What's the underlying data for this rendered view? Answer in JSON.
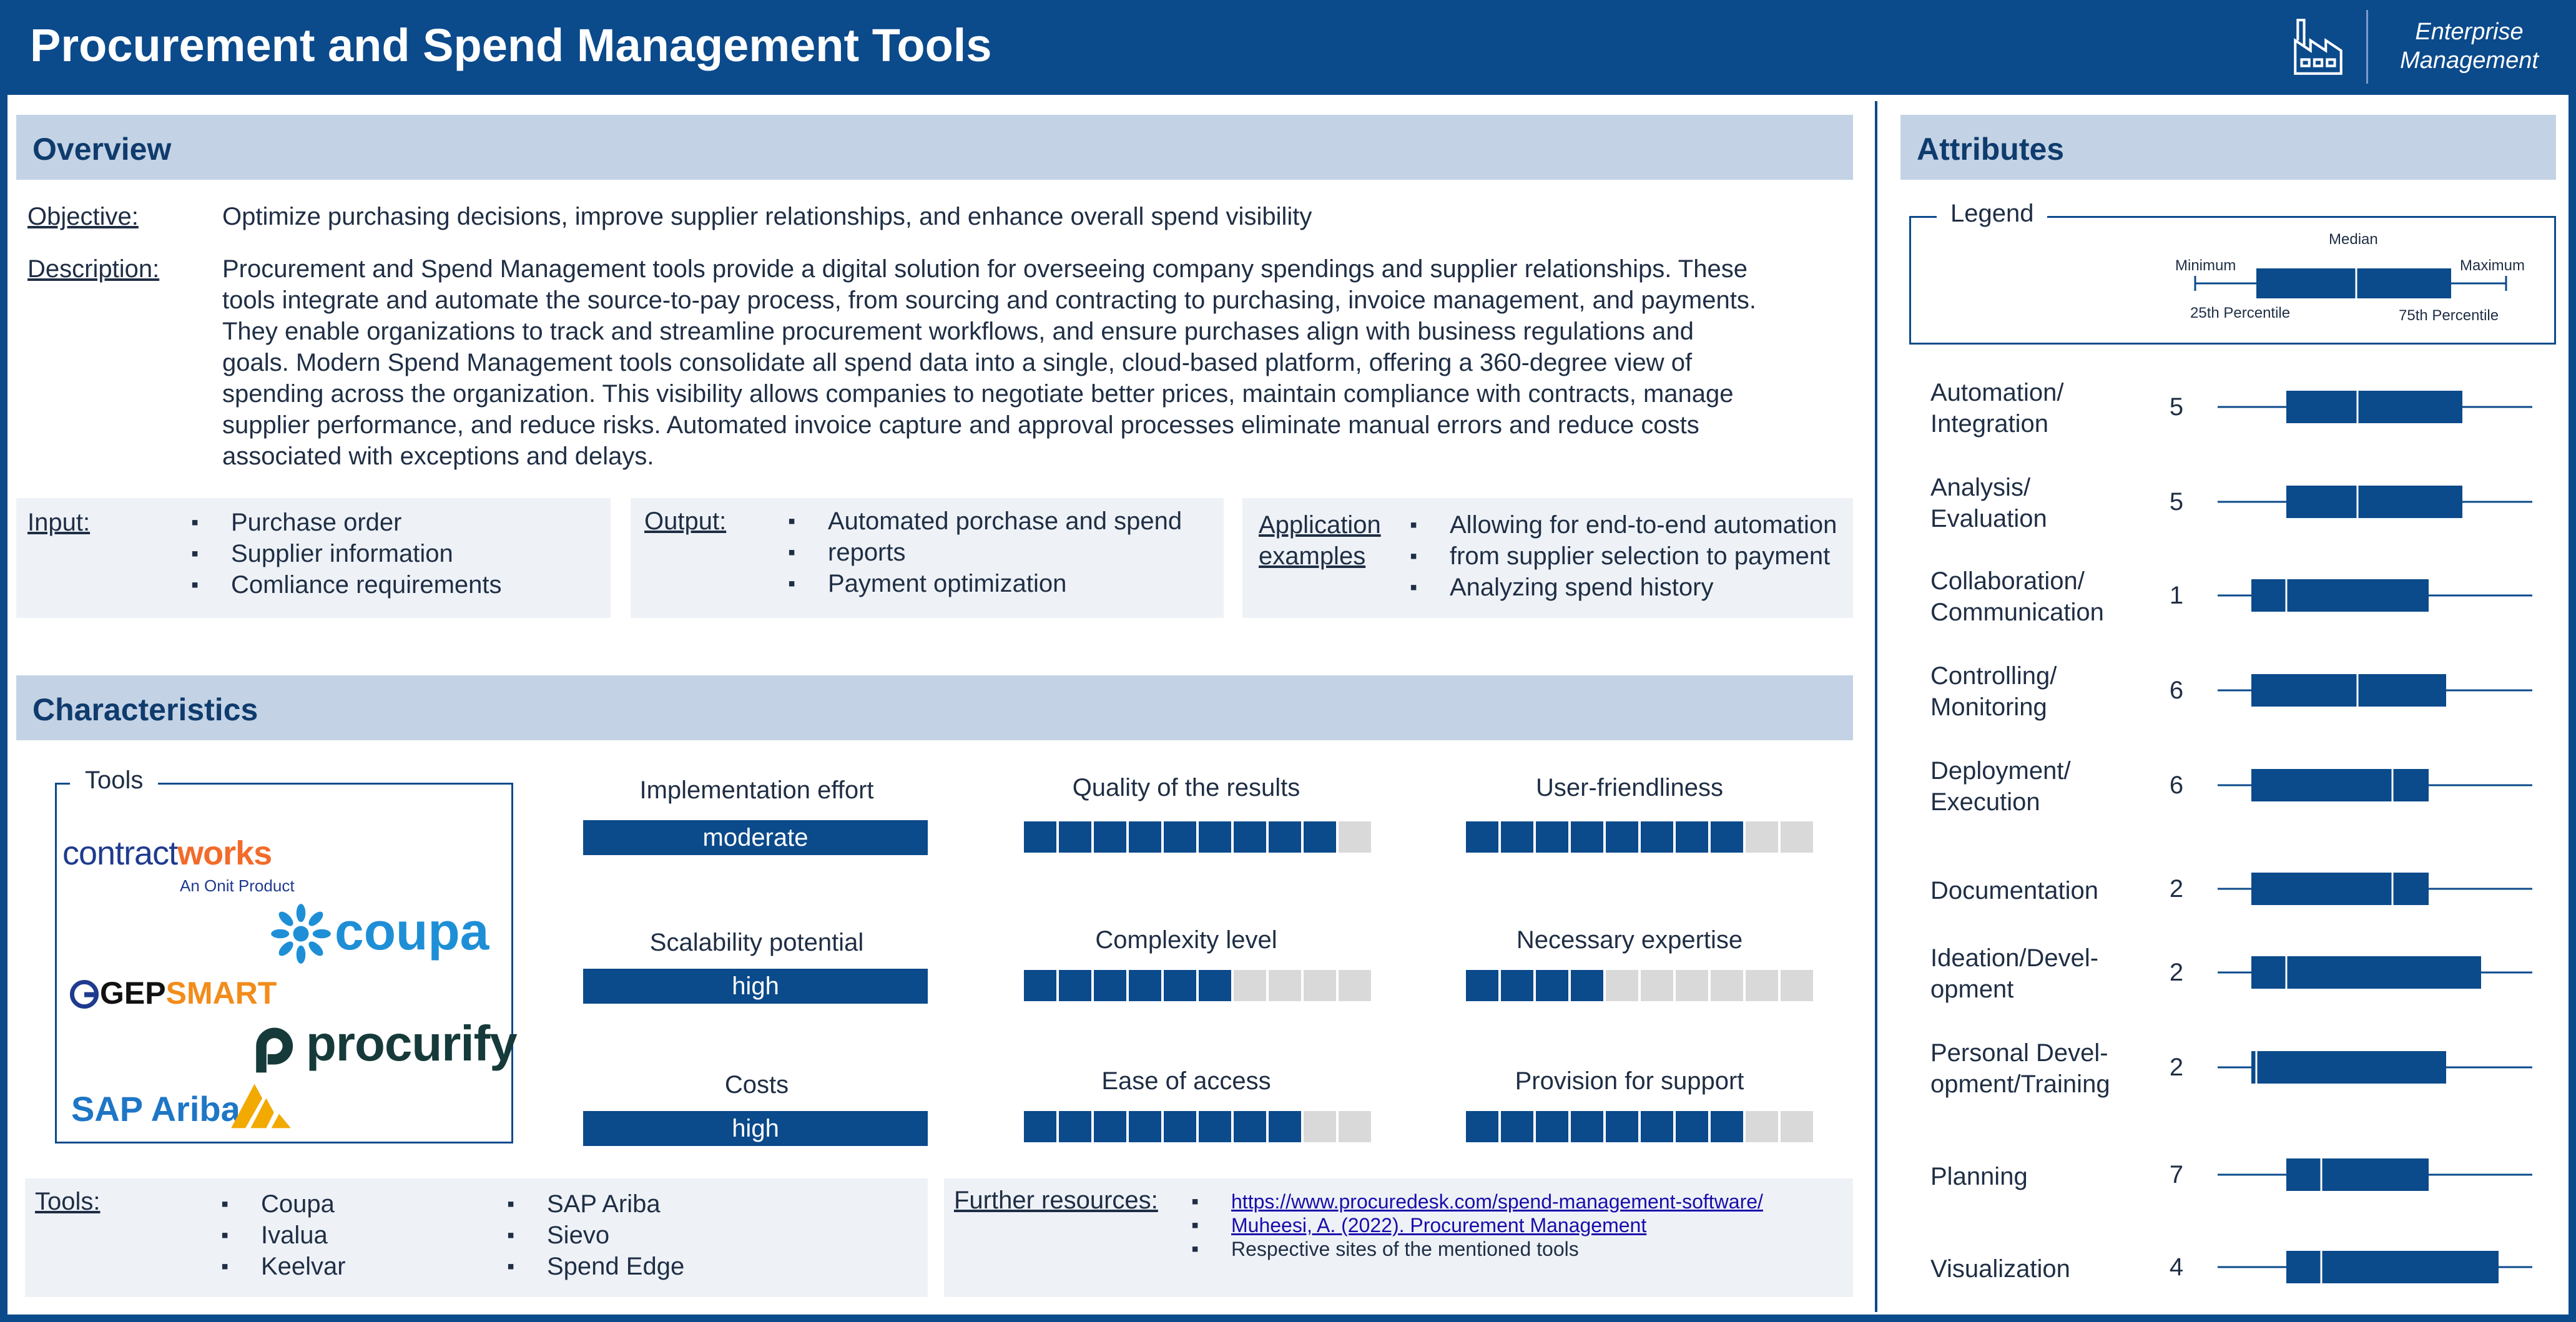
{
  "header": {
    "title": "Procurement and Spend Management Tools",
    "brand_line1": "Enterprise",
    "brand_line2": "Management",
    "icon": "factory-icon"
  },
  "overview": {
    "heading": "Overview",
    "objective_label": "Objective:",
    "objective_text": "Optimize purchasing decisions, improve supplier relationships, and enhance overall spend visibility",
    "description_label": "Description:",
    "description_lines": [
      "Procurement and Spend Management tools provide a digital solution for overseeing company spendings and supplier relationships. These",
      "tools integrate and automate the source-to-pay process, from sourcing and contracting to purchasing, invoice management, and payments.",
      "They enable organizations to track and streamline procurement workflows, and ensure purchases align with business regulations and",
      "goals. Modern Spend Management tools consolidate all spend data into a single, cloud-based platform, offering a 360-degree view of",
      "spending across the organization. This visibility allows companies to negotiate better prices, maintain compliance with contracts, manage",
      "supplier performance, and reduce risks. Automated invoice capture and approval processes eliminate manual errors and reduce costs",
      "associated with exceptions and delays."
    ],
    "input_label": "Input:",
    "input_items": [
      "Purchase order",
      "Supplier information",
      "Comliance requirements"
    ],
    "output_label": "Output:",
    "output_items": [
      "Automated porchase and spend",
      "reports",
      "Payment optimization"
    ],
    "app_label_1": "Application",
    "app_label_2": "examples",
    "app_items": [
      "Allowing for end-to-end automation",
      "from supplier selection to payment",
      "Analyzing spend history"
    ]
  },
  "characteristics": {
    "heading": "Characteristics",
    "tools_title": "Tools",
    "logos": {
      "contractworks_a": "contract",
      "contractworks_b": "works",
      "contractworks_sub": "An Onit Product",
      "coupa": "coupa",
      "gep_a": "GEP",
      "gep_b": "SMART",
      "procurify": "procurify",
      "sap": "SAP Ariba"
    },
    "categorical": [
      {
        "label": "Implementation effort",
        "value": "moderate"
      },
      {
        "label": "Scalability potential",
        "value": "high"
      },
      {
        "label": "Costs",
        "value": "high"
      }
    ],
    "ratings": [
      {
        "label": "Quality of the results",
        "filled": 9,
        "total": 10
      },
      {
        "label": "User-friendliness",
        "filled": 8,
        "total": 10
      },
      {
        "label": "Complexity level",
        "filled": 6,
        "total": 10
      },
      {
        "label": "Necessary expertise",
        "filled": 4,
        "total": 10
      },
      {
        "label": "Ease of access",
        "filled": 8,
        "total": 10
      },
      {
        "label": "Provision for support",
        "filled": 8,
        "total": 10
      }
    ],
    "tools_label": "Tools:",
    "tools_col1": [
      "Coupa",
      "Ivalua",
      "Keelvar"
    ],
    "tools_col2": [
      "SAP Ariba",
      "Sievo",
      "Spend Edge"
    ],
    "resources_label": "Further resources:",
    "resources": [
      "https://www.procuredesk.com/spend-management-software/",
      "Muheesi, A. (2022). Procurement Management",
      "Respective sites of the mentioned tools"
    ]
  },
  "attributes": {
    "heading": "Attributes",
    "legend_title": "Legend",
    "legend_labels": {
      "median": "Median",
      "minimum": "Minimum",
      "maximum": "Maximum",
      "p25": "25th Percentile",
      "p75": "75th Percentile"
    },
    "items": [
      {
        "name_1": "Automation/",
        "name_2": "Integration",
        "value": "5"
      },
      {
        "name_1": "Analysis/",
        "name_2": "Evaluation",
        "value": "5"
      },
      {
        "name_1": "Collaboration/",
        "name_2": "Communication",
        "value": "1"
      },
      {
        "name_1": "Controlling/",
        "name_2": "Monitoring",
        "value": "6"
      },
      {
        "name_1": "Deployment/",
        "name_2": "Execution",
        "value": "6"
      },
      {
        "name_1": "Documentation",
        "name_2": "",
        "value": "2"
      },
      {
        "name_1": "Ideation/Devel-",
        "name_2": "opment",
        "value": "2"
      },
      {
        "name_1": "Personal Devel-",
        "name_2": "opment/Training",
        "value": "2"
      },
      {
        "name_1": "Planning",
        "name_2": "",
        "value": "7"
      },
      {
        "name_1": "Visualization",
        "name_2": "",
        "value": "4"
      }
    ]
  },
  "colors": {
    "primary": "#0b4a8b",
    "band": "#c3d3e5",
    "panel": "#eef2f7",
    "empty_cell": "#d9d9d9"
  }
}
